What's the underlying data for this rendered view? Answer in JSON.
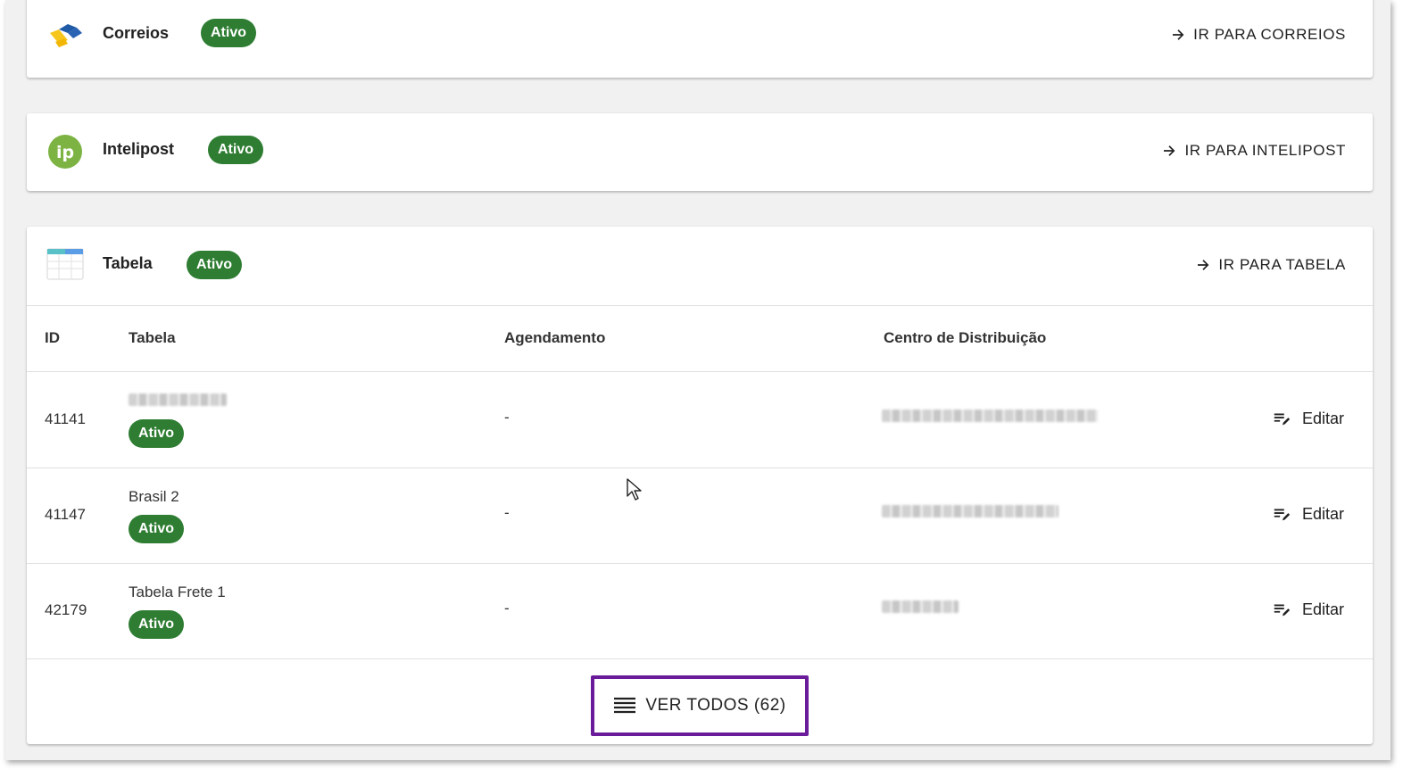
{
  "carriers": [
    {
      "name": "Correios",
      "status": "Ativo",
      "goto_label": "IR PARA CORREIOS",
      "icon": "correios-logo"
    },
    {
      "name": "Intelipost",
      "status": "Ativo",
      "goto_label": "IR PARA INTELIPOST",
      "icon": "intelipost-logo"
    },
    {
      "name": "Tabela",
      "status": "Ativo",
      "goto_label": "IR PARA TABELA",
      "icon": "table-icon"
    }
  ],
  "table": {
    "columns": {
      "id": "ID",
      "tabela": "Tabela",
      "agendamento": "Agendamento",
      "centro": "Centro de Distribuição"
    },
    "rows": [
      {
        "id": "41141",
        "name": "",
        "status": "Ativo",
        "agendamento": "-",
        "centro": "",
        "edit_label": "Editar"
      },
      {
        "id": "41147",
        "name": "Brasil 2",
        "status": "Ativo",
        "agendamento": "-",
        "centro": "",
        "edit_label": "Editar"
      },
      {
        "id": "42179",
        "name": "Tabela Frete 1",
        "status": "Ativo",
        "agendamento": "-",
        "centro": "",
        "edit_label": "Editar"
      }
    ]
  },
  "view_all_label": "VER TODOS (62)",
  "colors": {
    "active_chip": "#2e7d32",
    "highlight_border": "#6a1b9a",
    "intelipost_green": "#7cb342"
  }
}
